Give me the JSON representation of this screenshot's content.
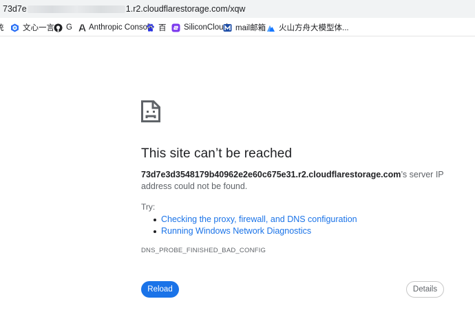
{
  "address_bar": {
    "url_start": "73d7e",
    "url_end": "1.r2.cloudflarestorage.com/xqw"
  },
  "bookmarks": [
    {
      "label": "统",
      "icon": "partial-bookmark-icon"
    },
    {
      "label": "文心一言",
      "icon": "wenxin-icon"
    },
    {
      "label": "G",
      "icon": "github-icon"
    },
    {
      "label": "Anthropic Console",
      "icon": "anthropic-icon"
    },
    {
      "label": "百",
      "icon": "baidu-paw-icon"
    },
    {
      "label": "SiliconCloud",
      "icon": "siliconcloud-icon"
    },
    {
      "label": "mail邮箱",
      "icon": "mail-icon"
    },
    {
      "label": "火山方舟大模型体...",
      "icon": "volcano-icon"
    }
  ],
  "error": {
    "title": "This site can’t be reached",
    "host": "73d7e3d3548179b40962e2e60c675e31.r2.cloudflarestorage.com",
    "message_rest": "’s server IP address could not be found.",
    "try_label": "Try:",
    "suggestions": [
      "Checking the proxy, firewall, and DNS configuration",
      "Running Windows Network Diagnostics"
    ],
    "error_code": "DNS_PROBE_FINISHED_BAD_CONFIG",
    "reload_label": "Reload",
    "details_label": "Details"
  },
  "colors": {
    "link": "#1a73e8",
    "primary_button": "#1a73e8",
    "text_secondary": "#5f6368",
    "toolbar_bg": "#f1f3f4"
  }
}
